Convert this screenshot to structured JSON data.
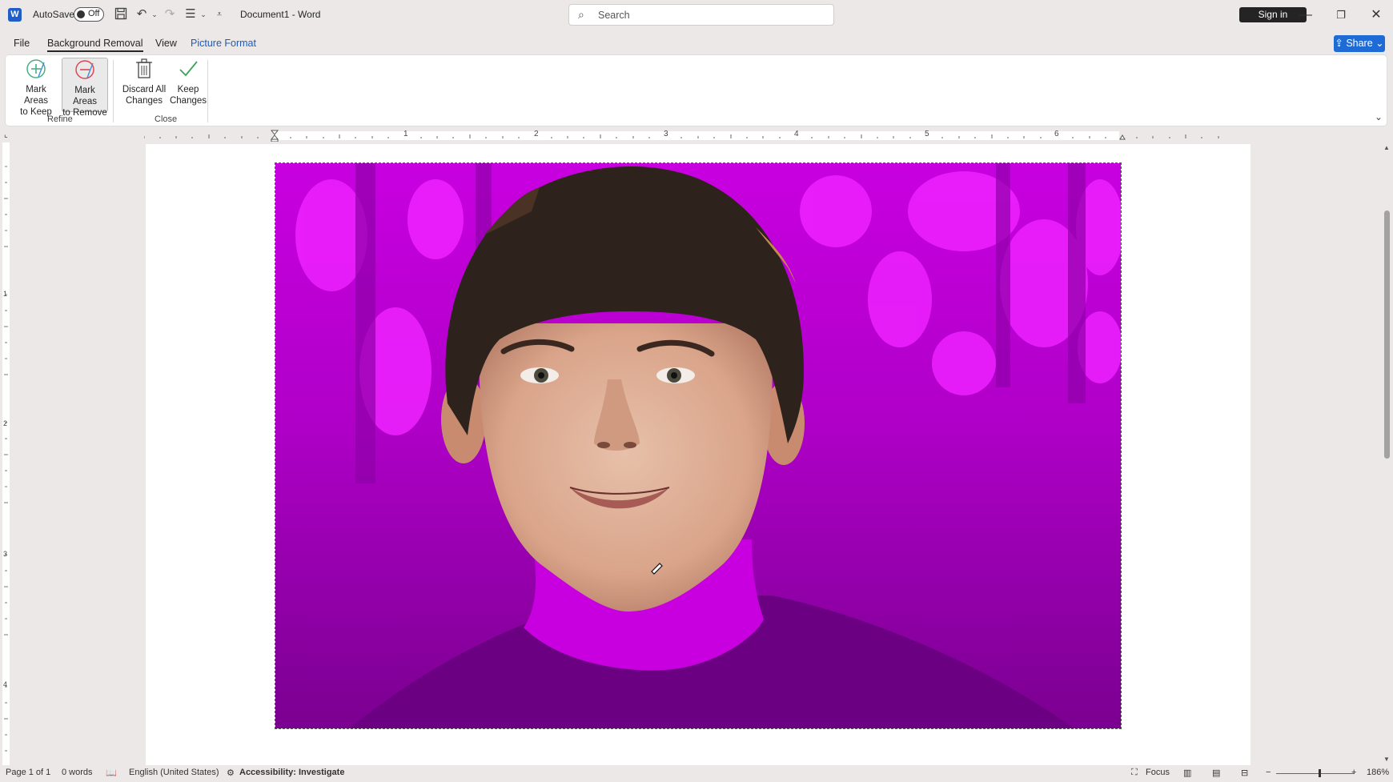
{
  "titlebar": {
    "logo_letter": "W",
    "autosave_label": "AutoSave",
    "autosave_state": "Off",
    "document_title": "Document1  -  Word",
    "search_placeholder": "Search",
    "signin_label": "Sign in",
    "icons": [
      "save-icon",
      "undo-icon",
      "redo-icon",
      "bullets-icon",
      "customize-qat-icon"
    ]
  },
  "menu": {
    "file": "File",
    "background_removal": "Background Removal",
    "view": "View",
    "picture_format": "Picture Format",
    "share": "Share"
  },
  "ribbon": {
    "mark_keep_line1": "Mark Areas",
    "mark_keep_line2": "to Keep",
    "mark_remove_line1": "Mark Areas",
    "mark_remove_line2": "to Remove",
    "discard_line1": "Discard All",
    "discard_line2": "Changes",
    "keep_line1": "Keep",
    "keep_line2": "Changes",
    "group_refine": "Refine",
    "group_close": "Close"
  },
  "ruler": {
    "numbers": [
      "1",
      "2",
      "3",
      "4",
      "5",
      "6"
    ],
    "vertical_numbers": [
      "1",
      "2",
      "3",
      "4"
    ]
  },
  "statusbar": {
    "page": "Page 1 of 1",
    "words": "0 words",
    "language": "English (United States)",
    "accessibility": "Accessibility: Investigate",
    "focus": "Focus",
    "zoom": "186%"
  },
  "colors": {
    "accent": "#1e6bd6",
    "removal_overlay": "#b000c8",
    "picture_format_tab": "#1e5bb8"
  }
}
